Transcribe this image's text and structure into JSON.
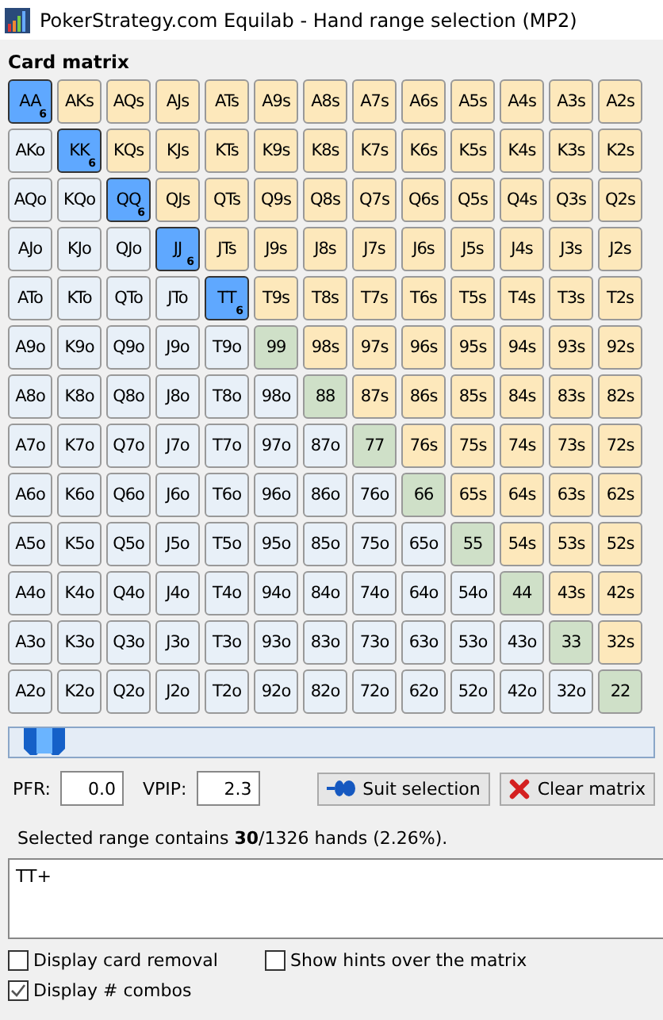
{
  "window": {
    "title": "PokerStrategy.com Equilab - Hand range selection (MP2)"
  },
  "matrix": {
    "title": "Card matrix",
    "rows": [
      [
        {
          "label": "AA",
          "kind": "pair",
          "selected": true,
          "combos": "6"
        },
        {
          "label": "AKs",
          "kind": "suited",
          "selected": false
        },
        {
          "label": "AQs",
          "kind": "suited",
          "selected": false
        },
        {
          "label": "AJs",
          "kind": "suited",
          "selected": false
        },
        {
          "label": "ATs",
          "kind": "suited",
          "selected": false
        },
        {
          "label": "A9s",
          "kind": "suited",
          "selected": false
        },
        {
          "label": "A8s",
          "kind": "suited",
          "selected": false
        },
        {
          "label": "A7s",
          "kind": "suited",
          "selected": false
        },
        {
          "label": "A6s",
          "kind": "suited",
          "selected": false
        },
        {
          "label": "A5s",
          "kind": "suited",
          "selected": false
        },
        {
          "label": "A4s",
          "kind": "suited",
          "selected": false
        },
        {
          "label": "A3s",
          "kind": "suited",
          "selected": false
        },
        {
          "label": "A2s",
          "kind": "suited",
          "selected": false
        }
      ],
      [
        {
          "label": "AKo",
          "kind": "offsuit",
          "selected": false
        },
        {
          "label": "KK",
          "kind": "pair",
          "selected": true,
          "combos": "6"
        },
        {
          "label": "KQs",
          "kind": "suited",
          "selected": false
        },
        {
          "label": "KJs",
          "kind": "suited",
          "selected": false
        },
        {
          "label": "KTs",
          "kind": "suited",
          "selected": false
        },
        {
          "label": "K9s",
          "kind": "suited",
          "selected": false
        },
        {
          "label": "K8s",
          "kind": "suited",
          "selected": false
        },
        {
          "label": "K7s",
          "kind": "suited",
          "selected": false
        },
        {
          "label": "K6s",
          "kind": "suited",
          "selected": false
        },
        {
          "label": "K5s",
          "kind": "suited",
          "selected": false
        },
        {
          "label": "K4s",
          "kind": "suited",
          "selected": false
        },
        {
          "label": "K3s",
          "kind": "suited",
          "selected": false
        },
        {
          "label": "K2s",
          "kind": "suited",
          "selected": false
        }
      ],
      [
        {
          "label": "AQo",
          "kind": "offsuit",
          "selected": false
        },
        {
          "label": "KQo",
          "kind": "offsuit",
          "selected": false
        },
        {
          "label": "QQ",
          "kind": "pair",
          "selected": true,
          "combos": "6"
        },
        {
          "label": "QJs",
          "kind": "suited",
          "selected": false
        },
        {
          "label": "QTs",
          "kind": "suited",
          "selected": false
        },
        {
          "label": "Q9s",
          "kind": "suited",
          "selected": false
        },
        {
          "label": "Q8s",
          "kind": "suited",
          "selected": false
        },
        {
          "label": "Q7s",
          "kind": "suited",
          "selected": false
        },
        {
          "label": "Q6s",
          "kind": "suited",
          "selected": false
        },
        {
          "label": "Q5s",
          "kind": "suited",
          "selected": false
        },
        {
          "label": "Q4s",
          "kind": "suited",
          "selected": false
        },
        {
          "label": "Q3s",
          "kind": "suited",
          "selected": false
        },
        {
          "label": "Q2s",
          "kind": "suited",
          "selected": false
        }
      ],
      [
        {
          "label": "AJo",
          "kind": "offsuit",
          "selected": false
        },
        {
          "label": "KJo",
          "kind": "offsuit",
          "selected": false
        },
        {
          "label": "QJo",
          "kind": "offsuit",
          "selected": false
        },
        {
          "label": "JJ",
          "kind": "pair",
          "selected": true,
          "combos": "6"
        },
        {
          "label": "JTs",
          "kind": "suited",
          "selected": false
        },
        {
          "label": "J9s",
          "kind": "suited",
          "selected": false
        },
        {
          "label": "J8s",
          "kind": "suited",
          "selected": false
        },
        {
          "label": "J7s",
          "kind": "suited",
          "selected": false
        },
        {
          "label": "J6s",
          "kind": "suited",
          "selected": false
        },
        {
          "label": "J5s",
          "kind": "suited",
          "selected": false
        },
        {
          "label": "J4s",
          "kind": "suited",
          "selected": false
        },
        {
          "label": "J3s",
          "kind": "suited",
          "selected": false
        },
        {
          "label": "J2s",
          "kind": "suited",
          "selected": false
        }
      ],
      [
        {
          "label": "ATo",
          "kind": "offsuit",
          "selected": false
        },
        {
          "label": "KTo",
          "kind": "offsuit",
          "selected": false
        },
        {
          "label": "QTo",
          "kind": "offsuit",
          "selected": false
        },
        {
          "label": "JTo",
          "kind": "offsuit",
          "selected": false
        },
        {
          "label": "TT",
          "kind": "pair",
          "selected": true,
          "combos": "6"
        },
        {
          "label": "T9s",
          "kind": "suited",
          "selected": false
        },
        {
          "label": "T8s",
          "kind": "suited",
          "selected": false
        },
        {
          "label": "T7s",
          "kind": "suited",
          "selected": false
        },
        {
          "label": "T6s",
          "kind": "suited",
          "selected": false
        },
        {
          "label": "T5s",
          "kind": "suited",
          "selected": false
        },
        {
          "label": "T4s",
          "kind": "suited",
          "selected": false
        },
        {
          "label": "T3s",
          "kind": "suited",
          "selected": false
        },
        {
          "label": "T2s",
          "kind": "suited",
          "selected": false
        }
      ],
      [
        {
          "label": "A9o",
          "kind": "offsuit",
          "selected": false
        },
        {
          "label": "K9o",
          "kind": "offsuit",
          "selected": false
        },
        {
          "label": "Q9o",
          "kind": "offsuit",
          "selected": false
        },
        {
          "label": "J9o",
          "kind": "offsuit",
          "selected": false
        },
        {
          "label": "T9o",
          "kind": "offsuit",
          "selected": false
        },
        {
          "label": "99",
          "kind": "pair",
          "selected": false
        },
        {
          "label": "98s",
          "kind": "suited",
          "selected": false
        },
        {
          "label": "97s",
          "kind": "suited",
          "selected": false
        },
        {
          "label": "96s",
          "kind": "suited",
          "selected": false
        },
        {
          "label": "95s",
          "kind": "suited",
          "selected": false
        },
        {
          "label": "94s",
          "kind": "suited",
          "selected": false
        },
        {
          "label": "93s",
          "kind": "suited",
          "selected": false
        },
        {
          "label": "92s",
          "kind": "suited",
          "selected": false
        }
      ],
      [
        {
          "label": "A8o",
          "kind": "offsuit",
          "selected": false
        },
        {
          "label": "K8o",
          "kind": "offsuit",
          "selected": false
        },
        {
          "label": "Q8o",
          "kind": "offsuit",
          "selected": false
        },
        {
          "label": "J8o",
          "kind": "offsuit",
          "selected": false
        },
        {
          "label": "T8o",
          "kind": "offsuit",
          "selected": false
        },
        {
          "label": "98o",
          "kind": "offsuit",
          "selected": false
        },
        {
          "label": "88",
          "kind": "pair",
          "selected": false
        },
        {
          "label": "87s",
          "kind": "suited",
          "selected": false
        },
        {
          "label": "86s",
          "kind": "suited",
          "selected": false
        },
        {
          "label": "85s",
          "kind": "suited",
          "selected": false
        },
        {
          "label": "84s",
          "kind": "suited",
          "selected": false
        },
        {
          "label": "83s",
          "kind": "suited",
          "selected": false
        },
        {
          "label": "82s",
          "kind": "suited",
          "selected": false
        }
      ],
      [
        {
          "label": "A7o",
          "kind": "offsuit",
          "selected": false
        },
        {
          "label": "K7o",
          "kind": "offsuit",
          "selected": false
        },
        {
          "label": "Q7o",
          "kind": "offsuit",
          "selected": false
        },
        {
          "label": "J7o",
          "kind": "offsuit",
          "selected": false
        },
        {
          "label": "T7o",
          "kind": "offsuit",
          "selected": false
        },
        {
          "label": "97o",
          "kind": "offsuit",
          "selected": false
        },
        {
          "label": "87o",
          "kind": "offsuit",
          "selected": false
        },
        {
          "label": "77",
          "kind": "pair",
          "selected": false
        },
        {
          "label": "76s",
          "kind": "suited",
          "selected": false
        },
        {
          "label": "75s",
          "kind": "suited",
          "selected": false
        },
        {
          "label": "74s",
          "kind": "suited",
          "selected": false
        },
        {
          "label": "73s",
          "kind": "suited",
          "selected": false
        },
        {
          "label": "72s",
          "kind": "suited",
          "selected": false
        }
      ],
      [
        {
          "label": "A6o",
          "kind": "offsuit",
          "selected": false
        },
        {
          "label": "K6o",
          "kind": "offsuit",
          "selected": false
        },
        {
          "label": "Q6o",
          "kind": "offsuit",
          "selected": false
        },
        {
          "label": "J6o",
          "kind": "offsuit",
          "selected": false
        },
        {
          "label": "T6o",
          "kind": "offsuit",
          "selected": false
        },
        {
          "label": "96o",
          "kind": "offsuit",
          "selected": false
        },
        {
          "label": "86o",
          "kind": "offsuit",
          "selected": false
        },
        {
          "label": "76o",
          "kind": "offsuit",
          "selected": false
        },
        {
          "label": "66",
          "kind": "pair",
          "selected": false
        },
        {
          "label": "65s",
          "kind": "suited",
          "selected": false
        },
        {
          "label": "64s",
          "kind": "suited",
          "selected": false
        },
        {
          "label": "63s",
          "kind": "suited",
          "selected": false
        },
        {
          "label": "62s",
          "kind": "suited",
          "selected": false
        }
      ],
      [
        {
          "label": "A5o",
          "kind": "offsuit",
          "selected": false
        },
        {
          "label": "K5o",
          "kind": "offsuit",
          "selected": false
        },
        {
          "label": "Q5o",
          "kind": "offsuit",
          "selected": false
        },
        {
          "label": "J5o",
          "kind": "offsuit",
          "selected": false
        },
        {
          "label": "T5o",
          "kind": "offsuit",
          "selected": false
        },
        {
          "label": "95o",
          "kind": "offsuit",
          "selected": false
        },
        {
          "label": "85o",
          "kind": "offsuit",
          "selected": false
        },
        {
          "label": "75o",
          "kind": "offsuit",
          "selected": false
        },
        {
          "label": "65o",
          "kind": "offsuit",
          "selected": false
        },
        {
          "label": "55",
          "kind": "pair",
          "selected": false
        },
        {
          "label": "54s",
          "kind": "suited",
          "selected": false
        },
        {
          "label": "53s",
          "kind": "suited",
          "selected": false
        },
        {
          "label": "52s",
          "kind": "suited",
          "selected": false
        }
      ],
      [
        {
          "label": "A4o",
          "kind": "offsuit",
          "selected": false
        },
        {
          "label": "K4o",
          "kind": "offsuit",
          "selected": false
        },
        {
          "label": "Q4o",
          "kind": "offsuit",
          "selected": false
        },
        {
          "label": "J4o",
          "kind": "offsuit",
          "selected": false
        },
        {
          "label": "T4o",
          "kind": "offsuit",
          "selected": false
        },
        {
          "label": "94o",
          "kind": "offsuit",
          "selected": false
        },
        {
          "label": "84o",
          "kind": "offsuit",
          "selected": false
        },
        {
          "label": "74o",
          "kind": "offsuit",
          "selected": false
        },
        {
          "label": "64o",
          "kind": "offsuit",
          "selected": false
        },
        {
          "label": "54o",
          "kind": "offsuit",
          "selected": false
        },
        {
          "label": "44",
          "kind": "pair",
          "selected": false
        },
        {
          "label": "43s",
          "kind": "suited",
          "selected": false
        },
        {
          "label": "42s",
          "kind": "suited",
          "selected": false
        }
      ],
      [
        {
          "label": "A3o",
          "kind": "offsuit",
          "selected": false
        },
        {
          "label": "K3o",
          "kind": "offsuit",
          "selected": false
        },
        {
          "label": "Q3o",
          "kind": "offsuit",
          "selected": false
        },
        {
          "label": "J3o",
          "kind": "offsuit",
          "selected": false
        },
        {
          "label": "T3o",
          "kind": "offsuit",
          "selected": false
        },
        {
          "label": "93o",
          "kind": "offsuit",
          "selected": false
        },
        {
          "label": "83o",
          "kind": "offsuit",
          "selected": false
        },
        {
          "label": "73o",
          "kind": "offsuit",
          "selected": false
        },
        {
          "label": "63o",
          "kind": "offsuit",
          "selected": false
        },
        {
          "label": "53o",
          "kind": "offsuit",
          "selected": false
        },
        {
          "label": "43o",
          "kind": "offsuit",
          "selected": false
        },
        {
          "label": "33",
          "kind": "pair",
          "selected": false
        },
        {
          "label": "32s",
          "kind": "suited",
          "selected": false
        }
      ],
      [
        {
          "label": "A2o",
          "kind": "offsuit",
          "selected": false
        },
        {
          "label": "K2o",
          "kind": "offsuit",
          "selected": false
        },
        {
          "label": "Q2o",
          "kind": "offsuit",
          "selected": false
        },
        {
          "label": "J2o",
          "kind": "offsuit",
          "selected": false
        },
        {
          "label": "T2o",
          "kind": "offsuit",
          "selected": false
        },
        {
          "label": "92o",
          "kind": "offsuit",
          "selected": false
        },
        {
          "label": "82o",
          "kind": "offsuit",
          "selected": false
        },
        {
          "label": "72o",
          "kind": "offsuit",
          "selected": false
        },
        {
          "label": "62o",
          "kind": "offsuit",
          "selected": false
        },
        {
          "label": "52o",
          "kind": "offsuit",
          "selected": false
        },
        {
          "label": "42o",
          "kind": "offsuit",
          "selected": false
        },
        {
          "label": "32o",
          "kind": "offsuit",
          "selected": false
        },
        {
          "label": "22",
          "kind": "pair",
          "selected": false
        }
      ]
    ]
  },
  "slider": {
    "level": 0.02
  },
  "pfr": {
    "label": "PFR:",
    "value": "0.0"
  },
  "vpip": {
    "label": "VPIP:",
    "value": "2.3"
  },
  "buttons": [
    {
      "kind": "suit",
      "label": "Suit selection"
    },
    {
      "kind": "clear",
      "label": "Clear matrix"
    }
  ],
  "summary": "Selected range contains **30**/1326 hands (2.26%).",
  "range_text": "TT+",
  "options": [
    {
      "label": "Display card removal",
      "checked": false
    },
    {
      "label": "Show hints over the matrix",
      "checked": false
    },
    {
      "label": "Display # combos",
      "checked": true
    }
  ]
}
